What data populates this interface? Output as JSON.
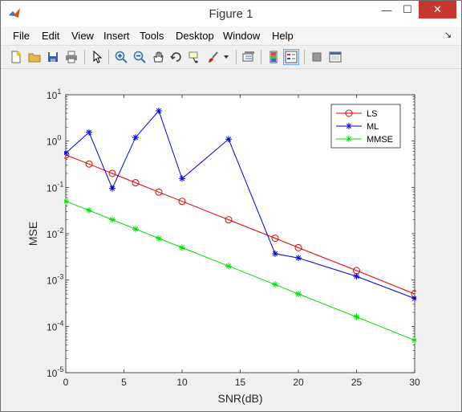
{
  "window": {
    "title": "Figure 1"
  },
  "menu": [
    "File",
    "Edit",
    "View",
    "Insert",
    "Tools",
    "Desktop",
    "Window",
    "Help"
  ],
  "menu_arrow": "↘",
  "toolbar": [
    "new-figure-icon",
    "open-file-icon",
    "save-icon",
    "print-icon",
    "pointer-icon",
    "zoom-in-icon",
    "zoom-out-icon",
    "pan-icon",
    "rotate-3d-icon",
    "data-cursor-icon",
    "brush-icon",
    "brush-dropdown-icon",
    "link-plot-icon",
    "colorbar-icon",
    "legend-icon",
    "hide-plot-tools-icon",
    "show-plot-tools-icon"
  ],
  "colors": {
    "LS": "#e00000",
    "ML": "#0000e0",
    "MMSE": "#00e000"
  },
  "chart_data": {
    "type": "line",
    "xlabel": "SNR(dB)",
    "ylabel": "MSE",
    "xlim": [
      0,
      30
    ],
    "ylim": [
      1e-05,
      10
    ],
    "yscale": "log",
    "grid": false,
    "legend_position": "top-right",
    "x_ticks": [
      "0",
      "5",
      "10",
      "15",
      "20",
      "25",
      "30"
    ],
    "y_ticks": [
      {
        "base": "10",
        "exp": "-5"
      },
      {
        "base": "10",
        "exp": "-4"
      },
      {
        "base": "10",
        "exp": "-3"
      },
      {
        "base": "10",
        "exp": "-2"
      },
      {
        "base": "10",
        "exp": "-1"
      },
      {
        "base": "10",
        "exp": "0"
      },
      {
        "base": "10",
        "exp": "1"
      }
    ],
    "series": [
      {
        "name": "LS",
        "marker": "o",
        "x": [
          0,
          2,
          4,
          6,
          8,
          10,
          14,
          18,
          20,
          25,
          30
        ],
        "y": [
          0.5,
          0.32,
          0.2,
          0.126,
          0.079,
          0.05,
          0.02,
          0.008,
          0.005,
          0.0016,
          0.0005
        ]
      },
      {
        "name": "ML",
        "marker": "*",
        "x": [
          0,
          2,
          4,
          6,
          8,
          10,
          14,
          18,
          20,
          25,
          30
        ],
        "y": [
          0.55,
          1.55,
          0.095,
          1.2,
          4.5,
          0.155,
          1.1,
          0.0037,
          0.003,
          0.0012,
          0.0004
        ]
      },
      {
        "name": "MMSE",
        "marker": "*",
        "x": [
          0,
          2,
          4,
          6,
          8,
          10,
          14,
          18,
          20,
          25,
          30
        ],
        "y": [
          0.05,
          0.032,
          0.02,
          0.0126,
          0.0079,
          0.005,
          0.002,
          0.0008,
          0.0005,
          0.00016,
          5e-05
        ]
      }
    ]
  }
}
